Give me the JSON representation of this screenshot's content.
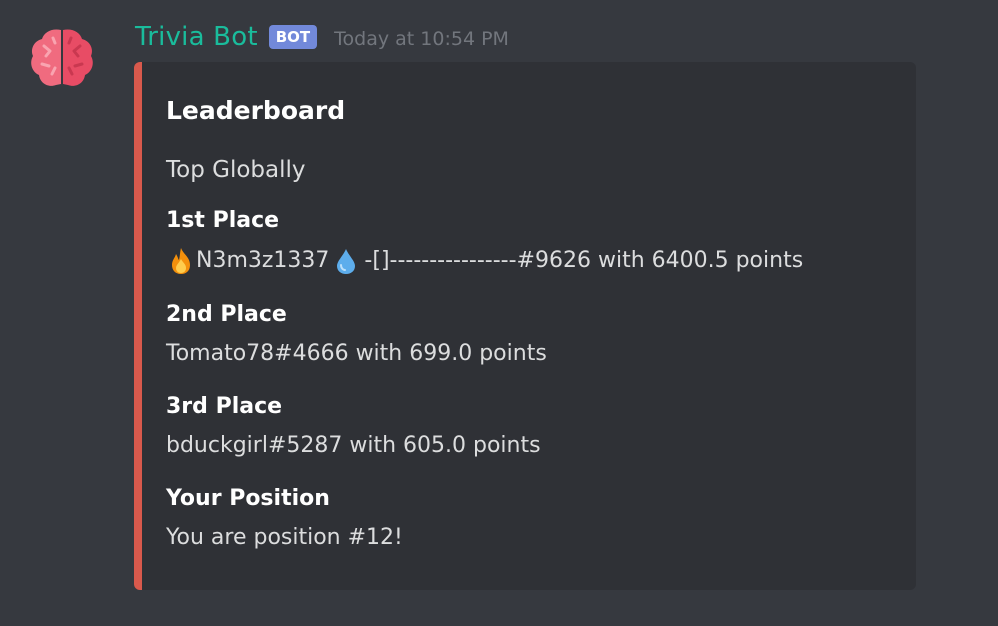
{
  "message": {
    "username": "Trivia Bot",
    "bot_tag": "BOT",
    "timestamp": "Today at 10:54 PM",
    "avatar_icon": "brain-icon"
  },
  "embed": {
    "accent_color": "#d9594c",
    "title": "Leaderboard",
    "description": "Top Globally",
    "fields": [
      {
        "name": "1st Place",
        "value_prefix_icon": "fire-emoji",
        "value_name": "N3m3z1337",
        "value_mid_icon": "droplet-emoji",
        "value_rest": "-[]----------------#9626 with 6400.5 points"
      },
      {
        "name": "2nd Place",
        "value": "Tomato78#4666 with 699.0 points"
      },
      {
        "name": "3rd Place",
        "value": "bduckgirl#5287 with 605.0 points"
      },
      {
        "name": "Your Position",
        "value": "You are position #12!"
      }
    ]
  },
  "colors": {
    "background": "#36393f",
    "embed_background": "#2f3136",
    "username": "#1abc9c",
    "bot_tag": "#7289da",
    "timestamp": "#72767d"
  }
}
